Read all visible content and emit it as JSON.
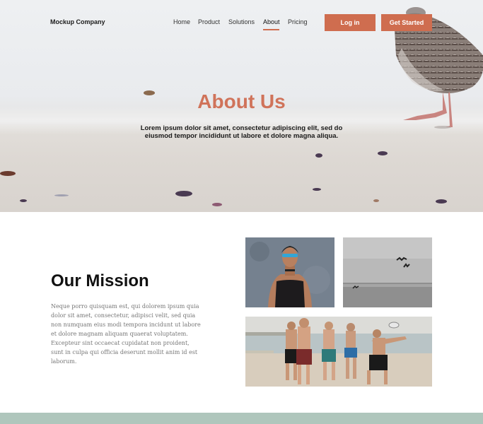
{
  "brand": "Mockup Company",
  "nav": {
    "items": [
      "Home",
      "Product",
      "Solutions",
      "About",
      "Pricing"
    ],
    "active": "About",
    "login_label": "Log in",
    "cta_label": "Get Started"
  },
  "hero": {
    "title": "About Us",
    "subtitle": "Lorem ipsum dolor sit amet, consectetur adipiscing elit, sed do eiusmod tempor incididunt ut labore et dolore magna aliqua."
  },
  "mission": {
    "title": "Our Mission",
    "body": "Neque porro quisquam est, qui dolorem ipsum quia dolor sit amet, consectetur, adipisci velit, sed quia non numquam eius modi tempora incidunt ut labore et dolore magnam aliquam quaerat voluptatem. Excepteur sint occaecat cupidatat non proident, sunt in culpa qui officia deserunt mollit anim id est laborum."
  },
  "colors": {
    "accent": "#cf6d4f",
    "title_accent": "#d0735a",
    "footer_band": "#afc6bc"
  }
}
